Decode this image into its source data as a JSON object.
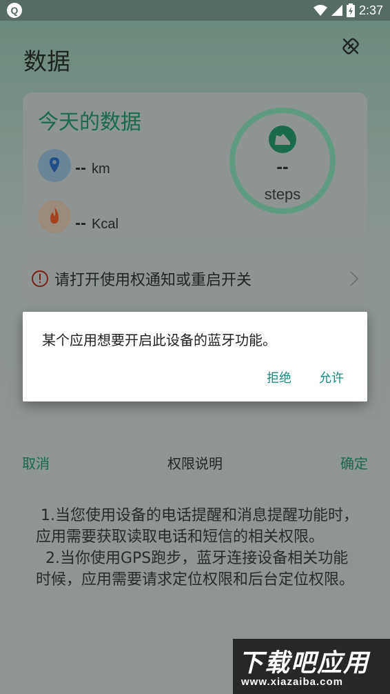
{
  "status_bar": {
    "app_icon": "Q",
    "time": "2:37"
  },
  "page": {
    "title": "数据",
    "link_icon": "link-off-icon",
    "card": {
      "title": "今天的数据",
      "distance": {
        "value": "--",
        "unit": "km",
        "icon": "location-pin-icon"
      },
      "calories": {
        "value": "--",
        "unit": "Kcal",
        "icon": "flame-icon"
      },
      "steps": {
        "value": "--",
        "unit": "steps",
        "icon": "shoe-icon"
      }
    },
    "notice": {
      "text": "请打开使用权通知或重启开关",
      "icon": "alert-circle-icon"
    }
  },
  "sheet": {
    "cancel": "取消",
    "title": "权限说明",
    "confirm": "确定",
    "body": " 1.当您使用设备的电话提醒和消息提醒功能时，应用需要获取读取电话和短信的相关权限。\n  2.当你使用GPS跑步，蓝牙连接设备相关功能时候，应用需要请求定位权限和后台定位权限。"
  },
  "dialog": {
    "message": "某个应用想要开启此设备的蓝牙功能。",
    "deny": "拒绝",
    "allow": "允许"
  },
  "watermark": {
    "main": "下载吧应用",
    "sub": "www.xiazaiba.com"
  },
  "colors": {
    "accent": "#1b8a7e",
    "brand_green": "#19694c",
    "status_bar": "#566b62"
  }
}
